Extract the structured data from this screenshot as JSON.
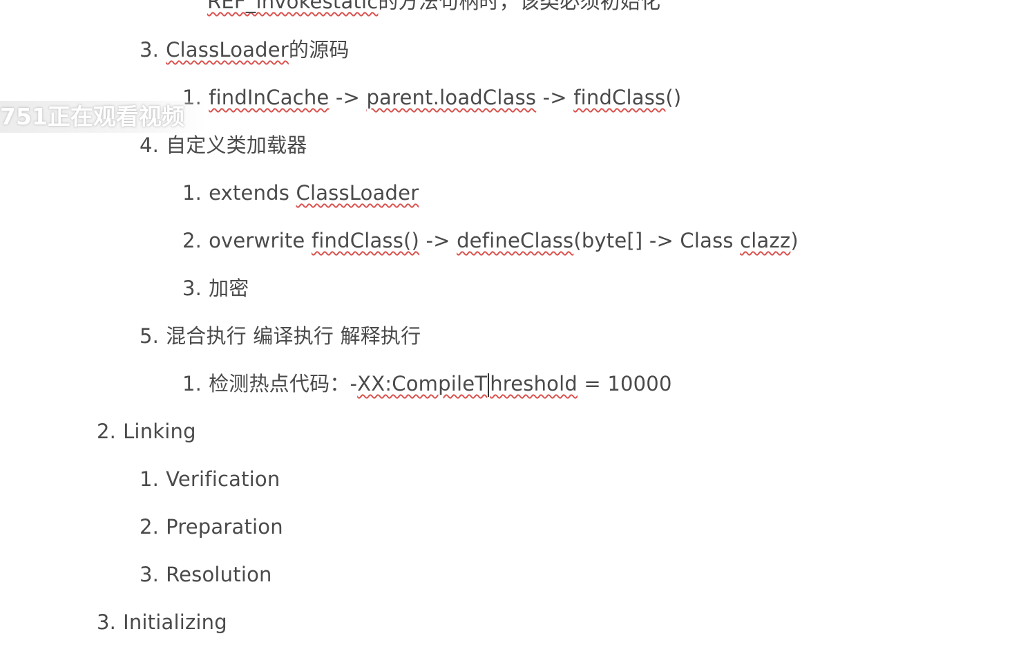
{
  "doc": {
    "top_partial": {
      "code": "REF_invokestatic",
      "rest": "的方法句柄时，该类必须初始化"
    },
    "item_3": {
      "num": "3.",
      "term": "ClassLoader",
      "rest": "的源码",
      "sub_1": {
        "num": "1.",
        "a": "findInCache",
        "arrow1": " -> ",
        "b": "parent.loadClass",
        "arrow2": " -> ",
        "c": "findClass",
        "c_tail": "()"
      }
    },
    "item_4": {
      "num": "4.",
      "text": "自定义类加载器",
      "sub_1": {
        "num": "1.",
        "pre": "extends ",
        "term": "ClassLoader"
      },
      "sub_2": {
        "num": "2.",
        "pre": "overwrite ",
        "a": "findClass()",
        "mid": " -> ",
        "b": "defineClass",
        "post": "(byte[] -> Class ",
        "c": "clazz",
        "end": ")"
      },
      "sub_3": {
        "num": "3.",
        "text": "加密"
      }
    },
    "item_5": {
      "num": "5.",
      "text": "混合执行 编译执行 解释执行",
      "sub_1": {
        "num": "1.",
        "pre": "检测热点代码：-",
        "a": "XX:CompileT",
        "b": "hreshold",
        "post": " = 10000"
      }
    },
    "linking": {
      "num": "2.",
      "text": "Linking",
      "items": [
        {
          "num": "1.",
          "text": "Verification"
        },
        {
          "num": "2.",
          "text": "Preparation"
        },
        {
          "num": "3.",
          "text": "Resolution"
        }
      ]
    },
    "initializing": {
      "num": "3.",
      "text": "Initializing"
    }
  },
  "overlay": {
    "text": "751正在观看视频"
  }
}
